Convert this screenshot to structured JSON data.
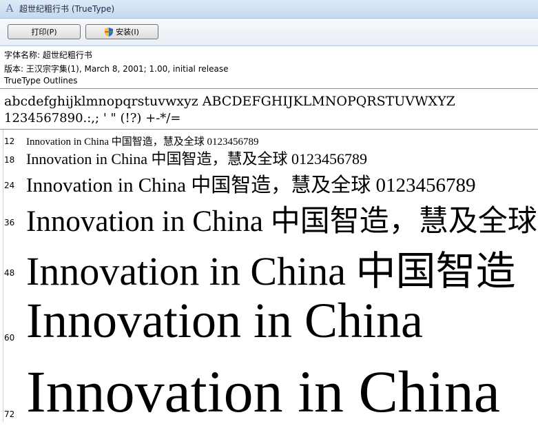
{
  "window": {
    "title": "超世纪粗行书 (TrueType)",
    "icon": "font-file-icon"
  },
  "toolbar": {
    "print_label": "打印(P)",
    "install_label": "安装(I)"
  },
  "info": {
    "font_name": "字体名称: 超世纪粗行书",
    "version": "版本: 王汉宗字集(1), March 8, 2001; 1.00, initial release",
    "type": "TrueType Outlines"
  },
  "charset": {
    "line1": "abcdefghijklmnopqrstuvwxyz  ABCDEFGHIJKLMNOPQRSTUVWXYZ",
    "line2": "1234567890.:,;  '  \"  (!?)  +-*/="
  },
  "samples": [
    {
      "size": "12",
      "text": "Innovation  in  China  中国智造，慧及全球  0123456789"
    },
    {
      "size": "18",
      "text": "Innovation  in  China  中国智造，慧及全球  0123456789"
    },
    {
      "size": "24",
      "text": "Innovation  in  China  中国智造，慧及全球  0123456789"
    },
    {
      "size": "36",
      "text": "Innovation  in  China  中国智造，慧及全球"
    },
    {
      "size": "48",
      "text": "Innovation  in  China  中国智造"
    },
    {
      "size": "60",
      "text": "Innovation  in  China"
    },
    {
      "size": "72",
      "text": "Innovation  in  China"
    }
  ]
}
